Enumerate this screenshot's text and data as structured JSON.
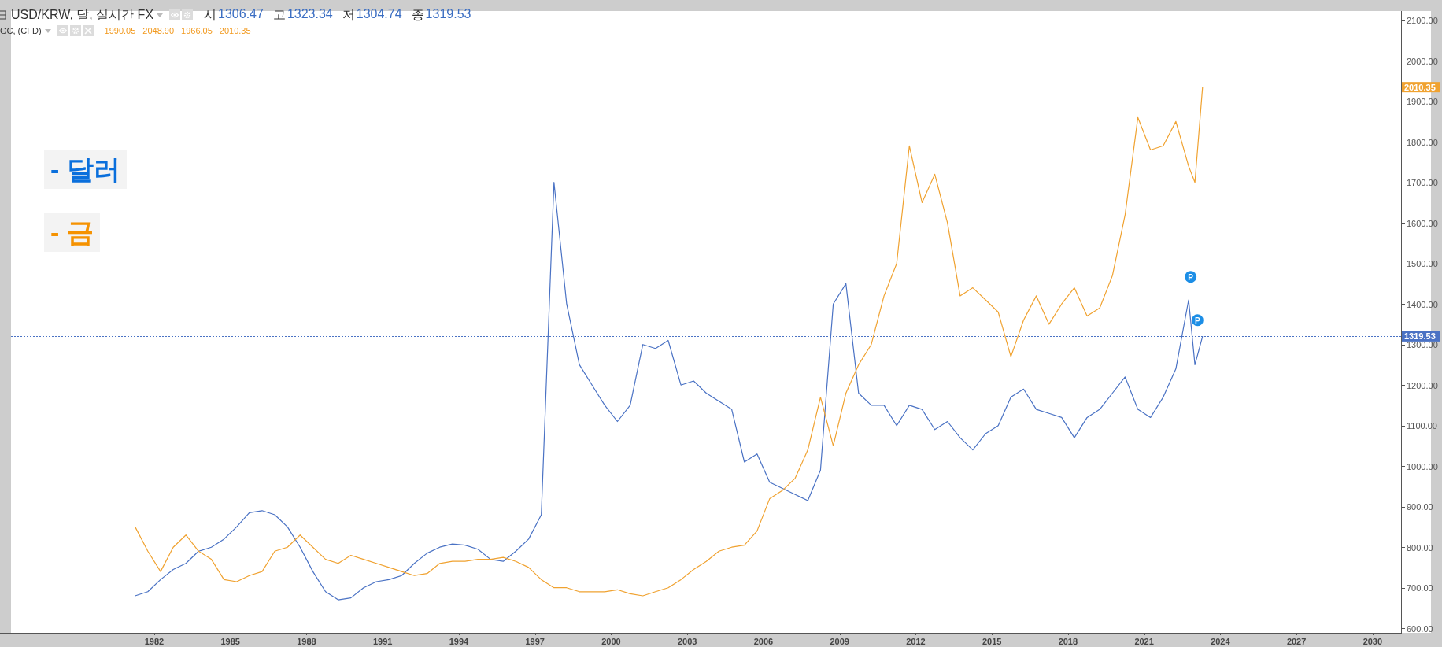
{
  "legend": [
    {
      "color": "#3a6dc2",
      "closable": false,
      "fields": [
        {
          "label": "시",
          "value": "1306.47"
        },
        {
          "label": "고",
          "value": "1323.34"
        },
        {
          "label": "저",
          "value": "1304.74"
        },
        {
          "label": "종",
          "value": "1319.53"
        }
      ]
    },
    {
      "color": "#f29a1f",
      "closable": true,
      "fields": [
        {
          "value": "1990.05"
        },
        {
          "value": "2048.90"
        },
        {
          "value": "1966.05"
        },
        {
          "value": "2010.35"
        }
      ]
    }
  ],
  "price_tags": [
    {
      "text": "2010.35",
      "color": "#f0a230",
      "line": false
    },
    {
      "text": "1319.53",
      "color": "#4a72c4",
      "line": true
    }
  ],
  "notes": [
    {
      "text": "- 달러",
      "color": "#0a6fdc"
    },
    {
      "text": "- 금",
      "color": "#f59200"
    }
  ],
  "chart_data": {
    "type": "line",
    "xlim": [
      1976.36,
      2031.12
    ],
    "ylim": [
      588.7,
      2122.7
    ],
    "x": [
      1981.25,
      1981.75,
      1982.25,
      1982.75,
      1983.25,
      1983.75,
      1984.25,
      1984.75,
      1985.25,
      1985.75,
      1986.25,
      1986.75,
      1987.25,
      1987.75,
      1988.25,
      1988.75,
      1989.25,
      1989.75,
      1990.25,
      1990.75,
      1991.25,
      1991.75,
      1992.25,
      1992.75,
      1993.25,
      1993.75,
      1994.25,
      1994.75,
      1995.25,
      1995.75,
      1996.25,
      1996.75,
      1997.25,
      1997.75,
      1998.25,
      1998.75,
      1999.25,
      1999.75,
      2000.25,
      2000.75,
      2001.25,
      2001.75,
      2002.25,
      2002.75,
      2003.25,
      2003.75,
      2004.25,
      2004.75,
      2005.25,
      2005.75,
      2006.25,
      2006.75,
      2007.25,
      2007.75,
      2008.25,
      2008.75,
      2009.25,
      2009.75,
      2010.25,
      2010.75,
      2011.25,
      2011.75,
      2012.25,
      2012.75,
      2013.25,
      2013.75,
      2014.25,
      2014.75,
      2015.25,
      2015.75,
      2016.25,
      2016.75,
      2017.25,
      2017.75,
      2018.25,
      2018.75,
      2019.25,
      2019.75,
      2020.25,
      2020.75,
      2021.25,
      2021.75,
      2022.25,
      2022.75,
      2023.0,
      2023.3
    ],
    "series": [
      {
        "name": "USD/KRW, 달, 실시간 FX",
        "color": "#4a72c4",
        "values": [
          680,
          690,
          720,
          745,
          760,
          790,
          800,
          820,
          850,
          885,
          890,
          880,
          850,
          800,
          740,
          690,
          670,
          675,
          700,
          715,
          720,
          730,
          760,
          785,
          800,
          808,
          805,
          795,
          770,
          765,
          790,
          820,
          880,
          1700,
          1400,
          1250,
          1200,
          1150,
          1110,
          1150,
          1300,
          1290,
          1310,
          1200,
          1210,
          1180,
          1160,
          1140,
          1010,
          1030,
          960,
          945,
          930,
          915,
          990,
          1400,
          1450,
          1180,
          1150,
          1150,
          1100,
          1150,
          1140,
          1090,
          1110,
          1070,
          1040,
          1080,
          1100,
          1170,
          1190,
          1140,
          1130,
          1120,
          1070,
          1120,
          1140,
          1180,
          1220,
          1140,
          1120,
          1170,
          1240,
          1410,
          1250,
          1320
        ]
      },
      {
        "name": "GC, (CFD)",
        "color": "#f0a230",
        "values": [
          850,
          790,
          740,
          800,
          830,
          790,
          770,
          720,
          715,
          730,
          740,
          790,
          800,
          830,
          800,
          770,
          760,
          780,
          770,
          760,
          750,
          740,
          730,
          735,
          760,
          765,
          765,
          770,
          770,
          775,
          765,
          750,
          720,
          700,
          700,
          690,
          690,
          690,
          695,
          685,
          680,
          690,
          700,
          720,
          745,
          765,
          790,
          800,
          805,
          840,
          920,
          940,
          970,
          1040,
          1170,
          1050,
          1180,
          1250,
          1300,
          1420,
          1500,
          1790,
          1650,
          1720,
          1600,
          1420,
          1440,
          1410,
          1380,
          1270,
          1360,
          1420,
          1350,
          1400,
          1440,
          1370,
          1390,
          1470,
          1620,
          1860,
          1780,
          1790,
          1850,
          1740,
          1700,
          1935
        ]
      }
    ],
    "xticks": [
      1982,
      1985,
      1988,
      1991,
      1994,
      1997,
      2000,
      2003,
      2006,
      2009,
      2012,
      2015,
      2018,
      2021,
      2024,
      2027,
      2030
    ],
    "yticks": [
      {
        "value": 600,
        "label": "600.00"
      },
      {
        "value": 700,
        "label": "700.00"
      },
      {
        "value": 800,
        "label": "800.00"
      },
      {
        "value": 900,
        "label": "900.00"
      },
      {
        "value": 1000,
        "label": "1000.00"
      },
      {
        "value": 1100,
        "label": "1100.00"
      },
      {
        "value": 1200,
        "label": "1200.00"
      },
      {
        "value": 1300,
        "label": "1300.00"
      },
      {
        "value": 1400,
        "label": "1400.00"
      },
      {
        "value": 1500,
        "label": "1500.00"
      },
      {
        "value": 1600,
        "label": "1600.00"
      },
      {
        "value": 1700,
        "label": "1700.00"
      },
      {
        "value": 1800,
        "label": "1800.00"
      },
      {
        "value": 1900,
        "label": "1900.00"
      },
      {
        "value": 2000,
        "label": "2000.00"
      },
      {
        "value": 2100,
        "label": "2100.00"
      }
    ],
    "annotations": [
      {
        "x": 2022.83,
        "y": 1467,
        "text": "P"
      },
      {
        "x": 2023.1,
        "y": 1360,
        "text": "P"
      }
    ]
  }
}
